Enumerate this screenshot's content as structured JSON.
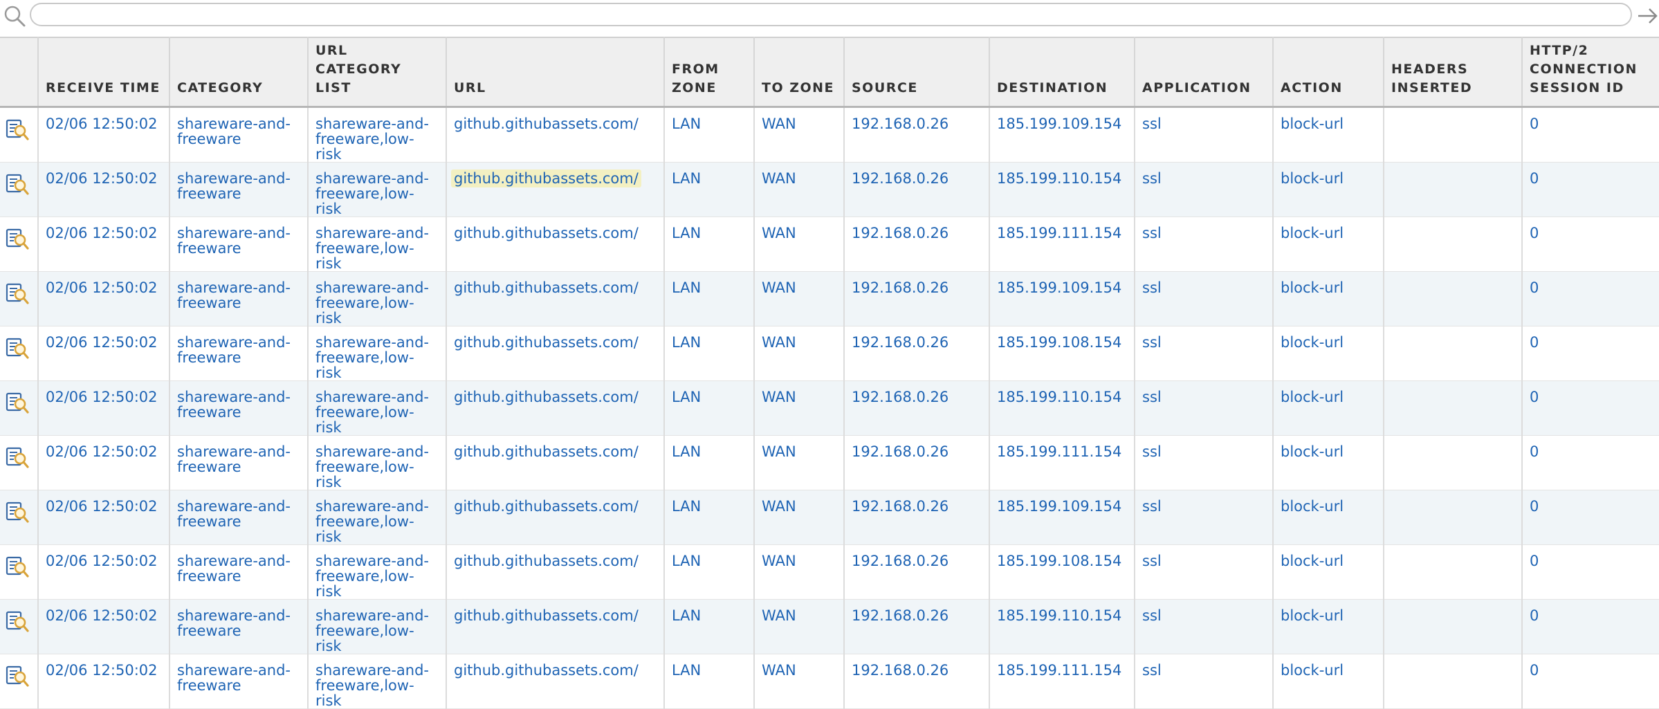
{
  "search": {
    "value": "",
    "placeholder": ""
  },
  "columns": [
    "",
    "RECEIVE TIME",
    "CATEGORY",
    "URL CATEGORY LIST",
    "URL",
    "FROM ZONE",
    "TO ZONE",
    "SOURCE",
    "DESTINATION",
    "APPLICATION",
    "ACTION",
    "HEADERS INSERTED",
    "HTTP/2 CONNECTION SESSION ID"
  ],
  "rows": [
    {
      "time": "02/06 12:50:02",
      "category": "shareware-and-freeware",
      "url_category_list": "shareware-and-freeware,low-risk",
      "url": "github.githubassets.com/",
      "from_zone": "LAN",
      "to_zone": "WAN",
      "source": "192.168.0.26",
      "destination": "185.199.109.154",
      "application": "ssl",
      "action": "block-url",
      "headers_inserted": "",
      "http2_session_id": "0"
    },
    {
      "time": "02/06 12:50:02",
      "category": "shareware-and-freeware",
      "url_category_list": "shareware-and-freeware,low-risk",
      "url": "github.githubassets.com/",
      "from_zone": "LAN",
      "to_zone": "WAN",
      "source": "192.168.0.26",
      "destination": "185.199.110.154",
      "application": "ssl",
      "action": "block-url",
      "headers_inserted": "",
      "http2_session_id": "0"
    },
    {
      "time": "02/06 12:50:02",
      "category": "shareware-and-freeware",
      "url_category_list": "shareware-and-freeware,low-risk",
      "url": "github.githubassets.com/",
      "from_zone": "LAN",
      "to_zone": "WAN",
      "source": "192.168.0.26",
      "destination": "185.199.111.154",
      "application": "ssl",
      "action": "block-url",
      "headers_inserted": "",
      "http2_session_id": "0"
    },
    {
      "time": "02/06 12:50:02",
      "category": "shareware-and-freeware",
      "url_category_list": "shareware-and-freeware,low-risk",
      "url": "github.githubassets.com/",
      "from_zone": "LAN",
      "to_zone": "WAN",
      "source": "192.168.0.26",
      "destination": "185.199.109.154",
      "application": "ssl",
      "action": "block-url",
      "headers_inserted": "",
      "http2_session_id": "0"
    },
    {
      "time": "02/06 12:50:02",
      "category": "shareware-and-freeware",
      "url_category_list": "shareware-and-freeware,low-risk",
      "url": "github.githubassets.com/",
      "from_zone": "LAN",
      "to_zone": "WAN",
      "source": "192.168.0.26",
      "destination": "185.199.108.154",
      "application": "ssl",
      "action": "block-url",
      "headers_inserted": "",
      "http2_session_id": "0"
    },
    {
      "time": "02/06 12:50:02",
      "category": "shareware-and-freeware",
      "url_category_list": "shareware-and-freeware,low-risk",
      "url": "github.githubassets.com/",
      "from_zone": "LAN",
      "to_zone": "WAN",
      "source": "192.168.0.26",
      "destination": "185.199.110.154",
      "application": "ssl",
      "action": "block-url",
      "headers_inserted": "",
      "http2_session_id": "0"
    },
    {
      "time": "02/06 12:50:02",
      "category": "shareware-and-freeware",
      "url_category_list": "shareware-and-freeware,low-risk",
      "url": "github.githubassets.com/",
      "from_zone": "LAN",
      "to_zone": "WAN",
      "source": "192.168.0.26",
      "destination": "185.199.111.154",
      "application": "ssl",
      "action": "block-url",
      "headers_inserted": "",
      "http2_session_id": "0"
    },
    {
      "time": "02/06 12:50:02",
      "category": "shareware-and-freeware",
      "url_category_list": "shareware-and-freeware,low-risk",
      "url": "github.githubassets.com/",
      "from_zone": "LAN",
      "to_zone": "WAN",
      "source": "192.168.0.26",
      "destination": "185.199.109.154",
      "application": "ssl",
      "action": "block-url",
      "headers_inserted": "",
      "http2_session_id": "0"
    },
    {
      "time": "02/06 12:50:02",
      "category": "shareware-and-freeware",
      "url_category_list": "shareware-and-freeware,low-risk",
      "url": "github.githubassets.com/",
      "from_zone": "LAN",
      "to_zone": "WAN",
      "source": "192.168.0.26",
      "destination": "185.199.108.154",
      "application": "ssl",
      "action": "block-url",
      "headers_inserted": "",
      "http2_session_id": "0"
    },
    {
      "time": "02/06 12:50:02",
      "category": "shareware-and-freeware",
      "url_category_list": "shareware-and-freeware,low-risk",
      "url": "github.githubassets.com/",
      "from_zone": "LAN",
      "to_zone": "WAN",
      "source": "192.168.0.26",
      "destination": "185.199.110.154",
      "application": "ssl",
      "action": "block-url",
      "headers_inserted": "",
      "http2_session_id": "0"
    },
    {
      "time": "02/06 12:50:02",
      "category": "shareware-and-freeware",
      "url_category_list": "shareware-and-freeware,low-risk",
      "url": "github.githubassets.com/",
      "from_zone": "LAN",
      "to_zone": "WAN",
      "source": "192.168.0.26",
      "destination": "185.199.111.154",
      "application": "ssl",
      "action": "block-url",
      "headers_inserted": "",
      "http2_session_id": "0"
    }
  ],
  "highlighted_row": 1,
  "icons": {
    "search": "search-icon",
    "submit": "arrow-right-icon",
    "row": "log-detail-icon"
  },
  "colors": {
    "link": "#1f64b4",
    "header_bg": "#efefef",
    "alt_row_bg": "#f0f5f8",
    "highlight": "#f3f0c2",
    "icon_blue": "#3a6aa5",
    "icon_gold": "#d9a43a"
  }
}
